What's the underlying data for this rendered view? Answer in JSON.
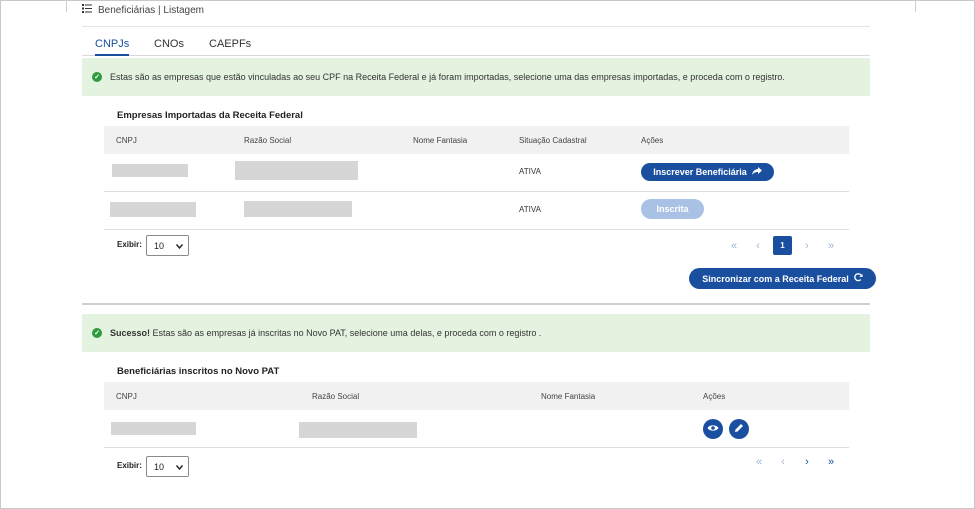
{
  "header": {
    "title": "Beneficiárias | Listagem",
    "icon": "list-icon"
  },
  "tabs": [
    {
      "label": "CNPJs",
      "active": true
    },
    {
      "label": "CNOs",
      "active": false
    },
    {
      "label": "CAEPFs",
      "active": false
    }
  ],
  "section1": {
    "alert": "Estas são as empresas que estão vinculadas ao seu CPF na Receita Federal e já foram importadas, selecione uma das empresas importadas, e proceda com o registro.",
    "title": "Empresas Importadas da Receita Federal",
    "columns": [
      "CNPJ",
      "Razão Social",
      "Nome Fantasia",
      "Situação Cadastral",
      "Ações"
    ],
    "rows": [
      {
        "situacao": "ATIVA",
        "action": "Inscrever Beneficiária",
        "action_enabled": true
      },
      {
        "situacao": "ATIVA",
        "action": "Inscrita",
        "action_enabled": false
      }
    ],
    "exibir_label": "Exibir:",
    "page_size": "10",
    "current_page": "1",
    "sync_button": "Sincronizar com a Receita Federal"
  },
  "section2": {
    "alert_bold": "Sucesso!",
    "alert": " Estas são as empresas já inscritas no Novo PAT, selecione uma delas, e proceda com o registro .",
    "title": "Beneficiárias inscritos no Novo PAT",
    "columns": [
      "CNPJ",
      "Razão Social",
      "Nome Fantasia",
      "Ações"
    ],
    "exibir_label": "Exibir:",
    "page_size": "10"
  },
  "colors": {
    "primary": "#1a4fa0",
    "success_bg": "#e3f3df",
    "success_icon": "#2e9b3f"
  }
}
